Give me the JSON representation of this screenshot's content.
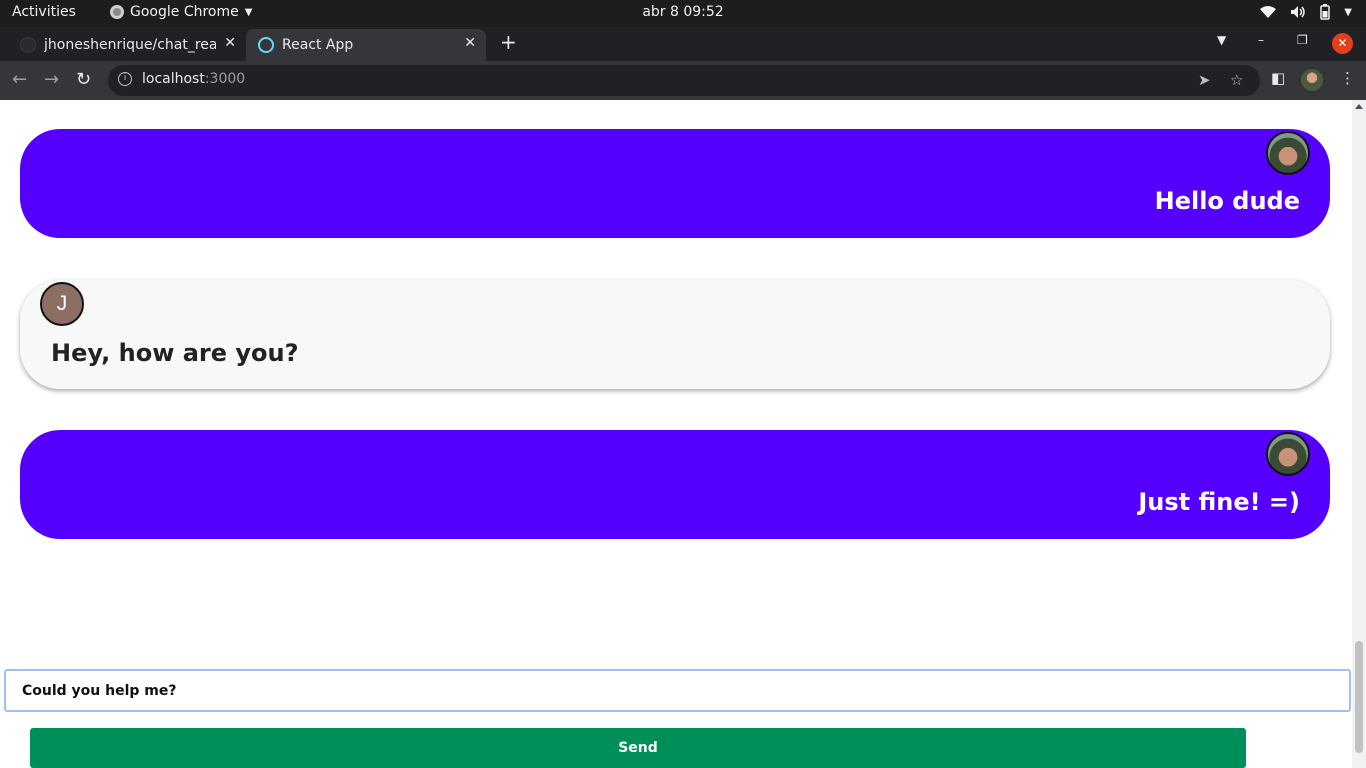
{
  "os_bar": {
    "activities": "Activities",
    "app_name": "Google Chrome",
    "clock": "abr 8  09:52",
    "icons": [
      "wifi-icon",
      "volume-icon",
      "battery-icon",
      "chevron-down-icon"
    ]
  },
  "browser": {
    "tabs": [
      {
        "title": "jhoneshenrique/chat_react",
        "favicon": "github-icon",
        "active": false
      },
      {
        "title": "React App",
        "favicon": "react-icon",
        "active": true
      }
    ],
    "url_host": "localhost",
    "url_port": ":3000",
    "toolbar_icons": [
      "back-icon",
      "forward-icon",
      "reload-icon",
      "info-icon",
      "send-tab-icon",
      "star-icon",
      "side-panel-icon",
      "profile-avatar",
      "more-icon"
    ]
  },
  "chat": {
    "messages": [
      {
        "text": "Hello dude",
        "sender": "self",
        "avatar": "photo"
      },
      {
        "text": "Hey, how are you?",
        "sender": "other",
        "avatar_letter": "J"
      },
      {
        "text": "Just fine! =)",
        "sender": "self",
        "avatar": "photo"
      }
    ],
    "input_value": "Could you help me?",
    "send_label": "Send"
  },
  "colors": {
    "own_bubble": "#5500ff",
    "other_bubble": "#f8f8f8",
    "send_button": "#008f59"
  }
}
